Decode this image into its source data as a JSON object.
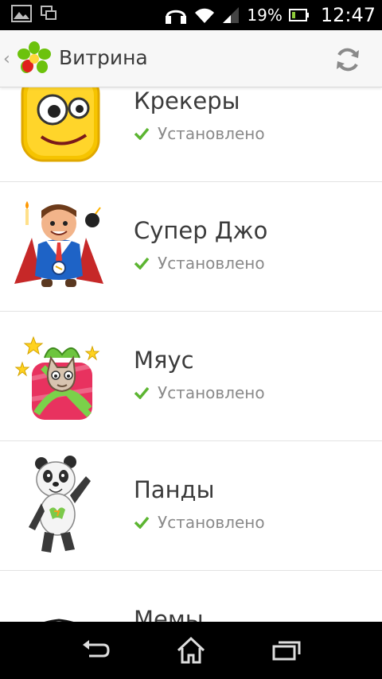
{
  "status_bar": {
    "battery_percent": "19%",
    "time": "12:47",
    "icons": [
      "image-notification-icon",
      "screenshot-notification-icon",
      "headset-icon",
      "wifi-icon",
      "signal-icon",
      "battery-icon"
    ]
  },
  "action_bar": {
    "title": "Витрина",
    "logo": "icq-flower-logo",
    "refresh_icon": "refresh-icon"
  },
  "list": {
    "items": [
      {
        "title": "Крекеры",
        "status": "Установлено",
        "image": "crackers-sticker"
      },
      {
        "title": "Супер Джо",
        "status": "Установлено",
        "image": "super-joe-sticker"
      },
      {
        "title": "Мяус",
        "status": "Установлено",
        "image": "myaus-cat-sticker"
      },
      {
        "title": "Панды",
        "status": "Установлено",
        "image": "panda-sticker"
      },
      {
        "title": "Мемы",
        "status": "",
        "image": "memes-troll-face-sticker"
      }
    ]
  },
  "colors": {
    "status_bar_bg": "#000000",
    "action_bar_bg": "#f7f7f7",
    "check_green": "#5cb531",
    "title_text": "#3b3b3b",
    "status_text": "#8a8a8a"
  },
  "nav_bar": {
    "icons": [
      "back-icon",
      "home-icon",
      "recent-apps-icon"
    ]
  }
}
